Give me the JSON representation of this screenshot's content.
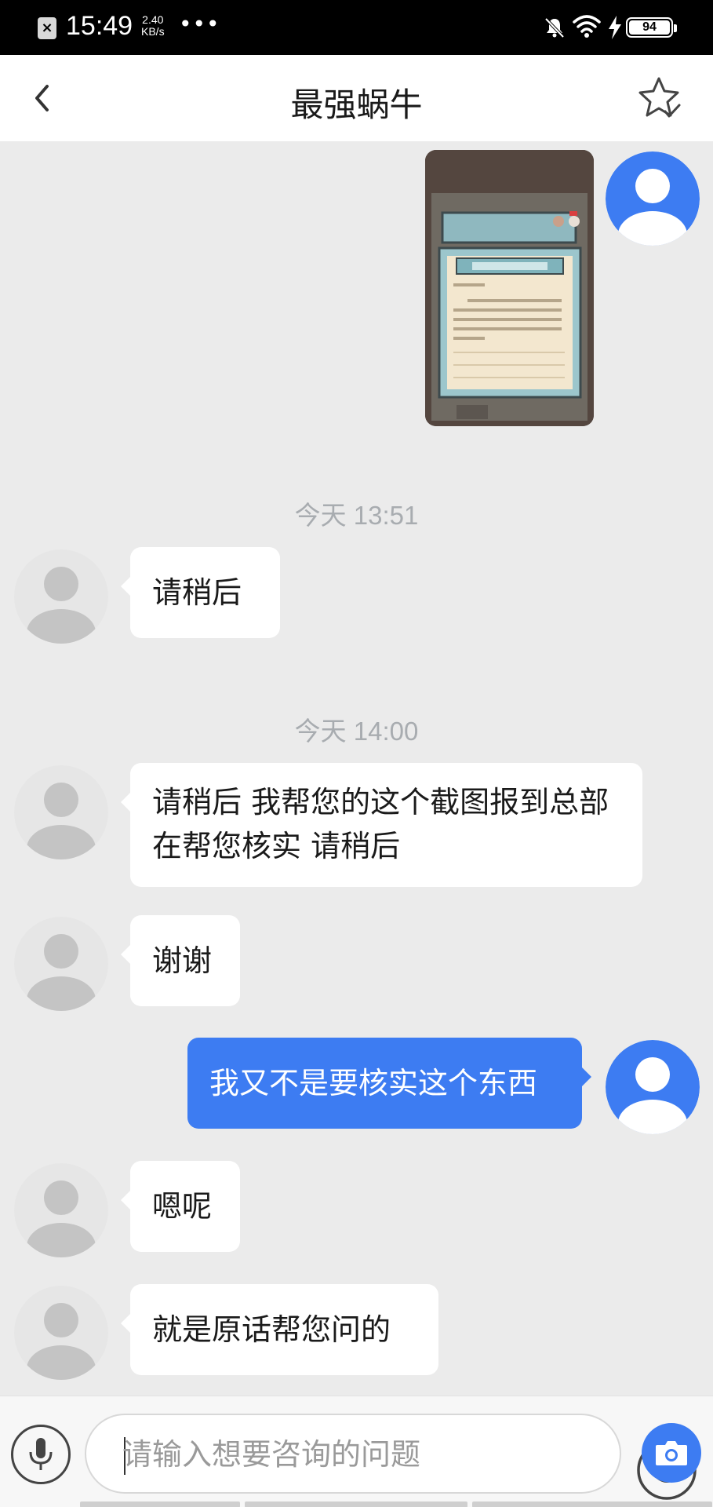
{
  "status_bar": {
    "time": "15:49",
    "net_speed_value": "2.40",
    "net_speed_unit": "KB/s",
    "more_dots": "•••",
    "battery": "94"
  },
  "header": {
    "title": "最强蜗牛"
  },
  "messages": [
    {
      "type": "timestamp",
      "text": "今天 13:51"
    },
    {
      "type": "text",
      "from": "agent",
      "text": "请稍后"
    },
    {
      "type": "timestamp",
      "text": "今天 14:00"
    },
    {
      "type": "text",
      "from": "agent",
      "text": "请稍后 我帮您的这个截图报到总部 在帮您核实  请稍后"
    },
    {
      "type": "text",
      "from": "agent",
      "text": "谢谢"
    },
    {
      "type": "text",
      "from": "user",
      "text": "我又不是要核实这个东西"
    },
    {
      "type": "text",
      "from": "agent",
      "text": "嗯呢"
    },
    {
      "type": "text",
      "from": "agent",
      "text": "就是原话帮您问的"
    }
  ],
  "input": {
    "placeholder": "请输入想要咨询的问题"
  },
  "colors": {
    "accent": "#3d7cf2",
    "background": "#ebebeb",
    "avatar_agent": "#e6e6e6",
    "timestamp": "#a8acb0"
  }
}
